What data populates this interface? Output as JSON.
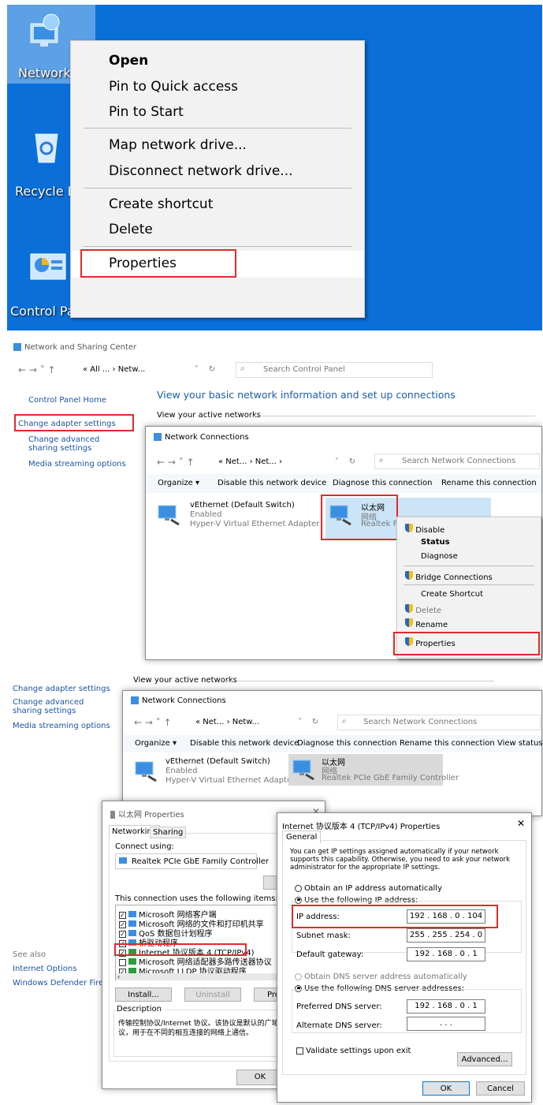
{
  "desktop": {
    "icons": [
      "Network",
      "Recycle Bin",
      "Control Panel"
    ],
    "context_menu": {
      "items": [
        "Open",
        "Pin to Quick access",
        "Pin to Start",
        "Map network drive...",
        "Disconnect network drive...",
        "Create shortcut",
        "Delete",
        "Properties"
      ]
    }
  },
  "nsc": {
    "title": "Network and Sharing Center",
    "breadcrumb": [
      "All ...",
      "Netw..."
    ],
    "search_placeholder": "Search Control Panel",
    "left_links": [
      "Control Panel Home",
      "Change adapter settings",
      "Change advanced sharing settings",
      "Media streaming options"
    ],
    "heading": "View your basic network information and set up connections",
    "active_networks": "View your active networks"
  },
  "nc": {
    "title": "Network Connections",
    "breadcrumb": [
      "Net...",
      "Net..."
    ],
    "search_placeholder": "Search Network Connections",
    "toolbar": [
      "Organize ▾",
      "Disable this network device",
      "Diagnose this connection",
      "Rename this connection"
    ],
    "adapter1": {
      "name": "vEthernet (Default Switch)",
      "status": "Enabled",
      "device": "Hyper-V Virtual Ethernet Adapter"
    },
    "adapter2": {
      "name": "以太网",
      "status": "网络",
      "device": "Realtek PC"
    },
    "menu": [
      "Disable",
      "Status",
      "Diagnose",
      "Bridge Connections",
      "Create Shortcut",
      "Delete",
      "Rename",
      "Properties"
    ]
  },
  "panel3": {
    "left_links": [
      "Change adapter settings",
      "Change advanced sharing settings",
      "Media streaming options"
    ],
    "see_also": "See also",
    "see_also_links": [
      "Internet Options",
      "Windows Defender Firewall"
    ],
    "active_networks": "View your active networks",
    "nc_title": "Network Connections",
    "breadcrumb": [
      "Net...",
      "Netw..."
    ],
    "search_placeholder": "Search Network Connections",
    "toolbar": [
      "Organize ▾",
      "Disable this network device",
      "Diagnose this connection",
      "Rename this connection",
      "View status of"
    ],
    "adapter1": {
      "name": "vEthernet (Default Switch)",
      "status": "Enabled",
      "device": "Hyper-V Virtual Ethernet Adapter"
    },
    "adapter2": {
      "name": "以太网",
      "status": "网络",
      "device": "Realtek PCIe GbE Family Controller"
    }
  },
  "eth_props": {
    "title": "以太网 Properties",
    "tabs": [
      "Networking",
      "Sharing"
    ],
    "connect_using": "Connect using:",
    "adapter": "Realtek PCIe GbE Family Controller",
    "configure_btn": "Co",
    "items_label": "This connection uses the following items:",
    "items": [
      "Microsoft 网络客户端",
      "Microsoft 网络的文件和打印机共享",
      "QoS 数据包计划程序",
      "桥驱动程序",
      "Internet 协议版本 4 (TCP/IPv4)",
      "Microsoft 网络适配器多路传送器协议",
      "Microsoft LLDP 协议驱动程序"
    ],
    "install_btn": "Install...",
    "uninstall_btn": "Uninstall",
    "prop_btn": "Pro",
    "description_label": "Description",
    "description": "传输控制协议/Internet 协议。该协议是默认的广域\n议，用于在不同的相互连接的网络上通信。",
    "ok_btn": "OK"
  },
  "ipv4": {
    "title": "Internet 协议版本 4 (TCP/IPv4) Properties",
    "tab": "General",
    "info": "You can get IP settings assigned automatically if your network supports this capability. Otherwise, you need to ask your network administrator for the appropriate IP settings.",
    "auto_ip": "Obtain an IP address automatically",
    "use_ip": "Use the following IP address:",
    "ip_label": "IP address:",
    "ip": "192 . 168 . 0 . 104",
    "mask_label": "Subnet mask:",
    "mask": "255 . 255 . 254 . 0",
    "gw_label": "Default gateway:",
    "gw": "192 . 168 . 0 . 1",
    "auto_dns": "Obtain DNS server address automatically",
    "use_dns": "Use the following DNS server addresses:",
    "pref_label": "Preferred DNS server:",
    "pref": "192 . 168 . 0 . 1",
    "alt_label": "Alternate DNS server:",
    "alt": ".   .   .",
    "validate": "Validate settings upon exit",
    "advanced_btn": "Advanced...",
    "ok_btn": "OK",
    "cancel_btn": "Cancel"
  }
}
